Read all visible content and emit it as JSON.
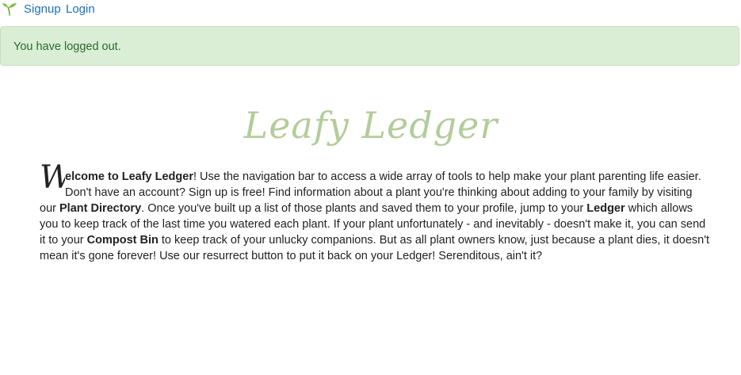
{
  "nav": {
    "signup_label": "Signup",
    "login_label": "Login"
  },
  "alert": {
    "message": "You have logged out."
  },
  "logo": {
    "text": "Leafy Ledger"
  },
  "intro": {
    "dropcap_letter": "W",
    "title_rest": "elcome to Leafy Ledger",
    "t1": "! Use the navigation bar to access a wide array of tools to help make your plant parenting life easier. Don't have an account? Sign up is free! Find information about a plant you're thinking about adding to your family by visiting our ",
    "plant_directory": "Plant Directory",
    "t2": ". Once you've built up a list of those plants and saved them to your profile, jump to your ",
    "ledger": "Ledger",
    "t3": " which allows you to keep track of the last time you watered each plant. If your plant unfortunately - and inevitably - doesn't make it, you can send it to your ",
    "compost_bin": "Compost Bin",
    "t4": " to keep track of your unlucky companions. But as all plant owners know, just because a plant dies, it doesn't mean it's gone forever! Use our resurrect button to put it back on your Ledger! Serenditous, ain't it?"
  },
  "colors": {
    "link": "#1f6fb2",
    "alert_bg": "#d9eed5",
    "alert_text": "#2b6b2e",
    "logo": "#b3cc99",
    "sprout": "#7bbf3e"
  },
  "icons": {
    "brand": "sprout-icon"
  }
}
